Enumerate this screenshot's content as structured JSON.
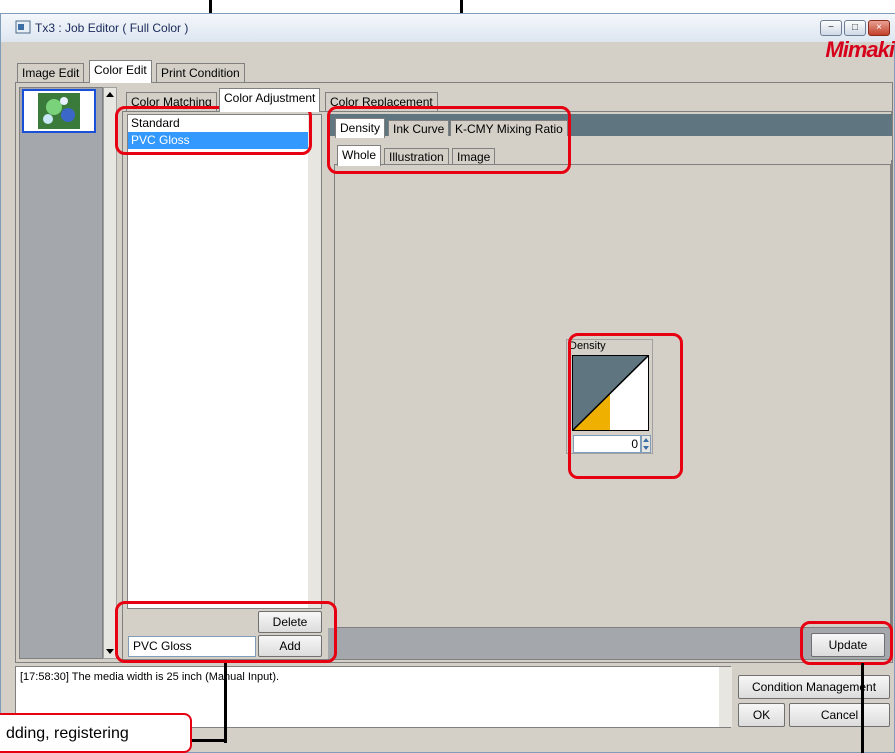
{
  "window": {
    "title": "Tx3 : Job Editor ( Full Color )",
    "logo": "Mimaki",
    "minimize": "−",
    "maximize": "□",
    "close": "×"
  },
  "main_tabs": [
    "Image Edit",
    "Color Edit",
    "Print Condition"
  ],
  "sub_tabs": [
    "Color Matching",
    "Color Adjustment",
    "Color Replacement"
  ],
  "adjustment_list": {
    "items": [
      "Standard",
      "PVC Gloss"
    ],
    "selected": "PVC Gloss"
  },
  "adjust_tabs": [
    "Density",
    "Ink Curve",
    "K-CMY Mixing Ratio"
  ],
  "scope_tabs": [
    "Whole",
    "Illustration",
    "Image"
  ],
  "density": {
    "label": "Density",
    "value": "0"
  },
  "buttons": {
    "delete": "Delete",
    "add": "Add",
    "update": "Update",
    "condition_management": "Condition Management",
    "ok": "OK",
    "cancel": "Cancel"
  },
  "name_field": {
    "value": "PVC Gloss"
  },
  "log": {
    "text": "[17:58:30] The media width is 25 inch (Manual Input)."
  },
  "callout": {
    "text": "dding, registering"
  },
  "colors": {
    "accent_red": "#e60012",
    "selection": "#3399ff",
    "density_dark": "#5f7580",
    "density_yellow": "#f0b000"
  }
}
